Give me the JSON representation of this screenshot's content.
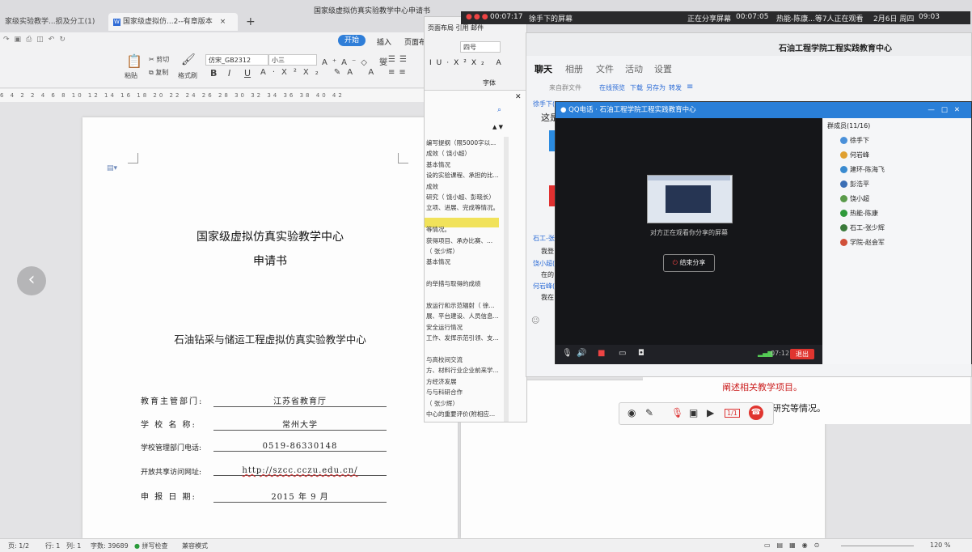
{
  "wps": {
    "doc_title": "国家级虚拟仿真实验教学中心申请书",
    "tabs": [
      {
        "label": "家级实验教学...损及分工(1)"
      },
      {
        "label": "国家级虚拟仿...2--有章版本"
      }
    ],
    "add_tab": "+",
    "ribbon_tabs": {
      "start": "开始",
      "insert": "插入",
      "page_layout": "页面布"
    },
    "ribbon": {
      "paste": "粘贴",
      "cut": "剪切",
      "copy": "复制",
      "format_painter": "格式刷",
      "font_name": "仿宋_GB2312",
      "font_size": "小三",
      "bold": "B",
      "italic": "I",
      "underline": "U"
    },
    "ruler": "6 4 2 2 4 6 8 10 12 14 16 18 20 22 24 26 28 30 32 34 36 38 40 42"
  },
  "document": {
    "title_line1": "国家级虚拟仿真实验教学中心",
    "title_line2": "申请书",
    "center_name": "石油钻采与储运工程虚拟仿真实验教学中心",
    "fields": [
      {
        "label": "教育主管部门:",
        "value": "江苏省教育厅"
      },
      {
        "label": "学 校 名 称:",
        "value": "常州大学"
      },
      {
        "label": "学校管理部门电话:",
        "value": "0519-86330148"
      },
      {
        "label": "开放共享访问网址:",
        "value": "http://szcc.cczu.edu.cn/"
      },
      {
        "label": "申 报 日 期:",
        "value": "2015 年 9 月"
      }
    ],
    "page2_note": "阐述相关教学项目。",
    "page2_note2": "研究等情况。"
  },
  "status_bar": {
    "page": "页: 1/2",
    "line": "行: 1",
    "col": "列: 1",
    "word_count": "字数: 39689",
    "spell_check": "拼写检查",
    "compat_mode": "兼容模式",
    "zoom": "120 %"
  },
  "side_window": {
    "menu": [
      "页面布局",
      "引用",
      "邮件"
    ],
    "font_size": "四号",
    "section_label": "字体",
    "outline": [
      "编写提纲（限5000字以...",
      "成效（ 饶小超）",
      "基本情况",
      "设的实验课程、承担的比...",
      "成效",
      "研究（ 饶小超、彭晓长）",
      "立项、进展、完成等情况。",
      "",
      "等情况。",
      "获得项目、承办比赛、...",
      "（ 张少辉）",
      "基本情况",
      "",
      "的举措与取得的成绩",
      "",
      "放运行和示范辐射（ 徐...",
      "展、平台建设、人员信息...",
      "安全运行情况",
      "工作、发挥示范引领、支...",
      "",
      "与高校间交流",
      "方、材料行业企业前来学...",
      "方经济发展",
      "与与科研合作",
      "（ 张少辉）",
      "中心的重要评价(附相应..."
    ]
  },
  "screen_bar": {
    "timer": "00:07:17",
    "title": "徐手下的屏幕",
    "sharing": "正在分享屏幕",
    "share_timer": "00:07:05",
    "viewers": "热能-陈康...等7人正在观看",
    "date": "2月6日 周四",
    "time": "09:03"
  },
  "qq_chat": {
    "group_title": "石油工程学院工程实践教育中心",
    "tabs": [
      "聊天",
      "相册",
      "文件",
      "活动",
      "设置"
    ],
    "links": [
      "来自群文件",
      "在线预览",
      "下载",
      "另存为",
      "转发"
    ],
    "messages": [
      {
        "sender": "徐手下(",
        "text": "这是"
      },
      {
        "sender": "石工-张",
        "text": "我登"
      },
      {
        "sender": "饶小超(",
        "text": "在的"
      },
      {
        "sender": "何岩峰(",
        "text": "我在"
      }
    ]
  },
  "qq_call": {
    "title_app": "QQ电话",
    "title_group": "石油工程学院工程实践教育中心",
    "watching_text": "对方正在观看你分享的屏幕",
    "end_share": "结束分享",
    "call_time": "07:12",
    "exit": "退出",
    "members_header": "群成员(11/16)",
    "members": [
      {
        "name": "徐手下",
        "color": "#4a90d9"
      },
      {
        "name": "何岩峰",
        "color": "#e0a030"
      },
      {
        "name": "建环-陈海飞",
        "color": "#3a8bd0"
      },
      {
        "name": "彭浩平",
        "color": "#3b6fb6"
      },
      {
        "name": "饶小超",
        "color": "#5a9a4a"
      },
      {
        "name": "热能-陈康",
        "color": "#2f9a3b"
      },
      {
        "name": "石工-张少辉",
        "color": "#3a7a3a"
      },
      {
        "name": "学院-赵会军",
        "color": "#d0503a"
      }
    ]
  },
  "float_toolbar": {
    "page_indicator": "1/1"
  }
}
